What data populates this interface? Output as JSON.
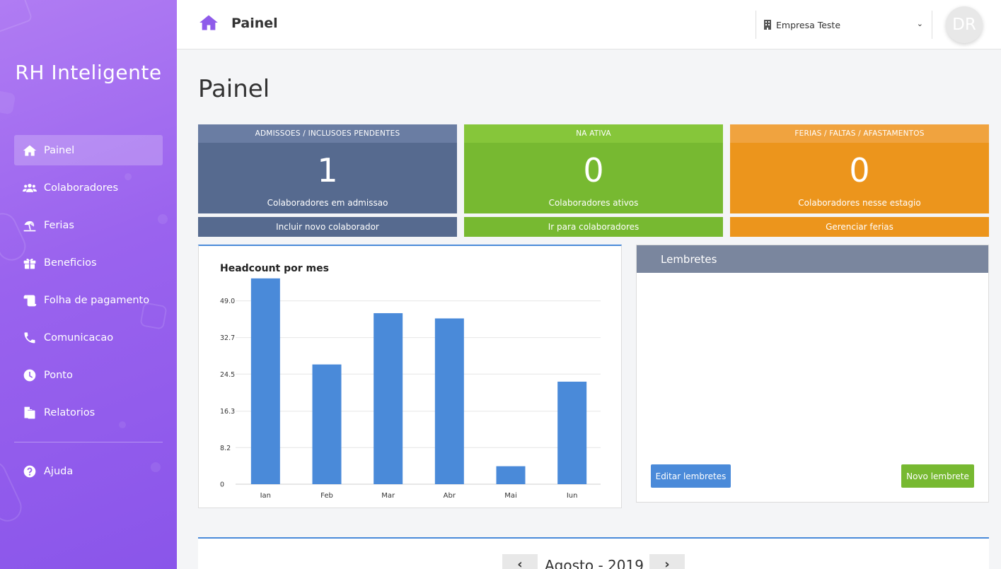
{
  "brand": "RH Inteligente",
  "sidebar": {
    "items": [
      {
        "label": "Painel",
        "icon": "home-icon",
        "active": true
      },
      {
        "label": "Colaboradores",
        "icon": "users-icon"
      },
      {
        "label": "Ferias",
        "icon": "umbrella-beach-icon"
      },
      {
        "label": "Beneficios",
        "icon": "gift-icon"
      },
      {
        "label": "Folha de pagamento",
        "icon": "scroll-icon"
      },
      {
        "label": "Comunicacao",
        "icon": "phone-icon"
      },
      {
        "label": "Ponto",
        "icon": "clock-icon"
      },
      {
        "label": "Relatorios",
        "icon": "copy-icon"
      }
    ],
    "help": {
      "label": "Ajuda",
      "icon": "question-circle-icon"
    }
  },
  "header": {
    "title": "Painel",
    "company": "Empresa Teste",
    "avatar_initials": "DR"
  },
  "page_title": "Painel",
  "stats": [
    {
      "header": "ADMISSOES / INCLUSOES PENDENTES",
      "value": "1",
      "caption": "Colaboradores em admissao",
      "action": "Incluir novo colaborador",
      "color": "#566a8f"
    },
    {
      "header": "NA ATIVA",
      "value": "0",
      "caption": "Colaboradores ativos",
      "action": "Ir para colaboradores",
      "color": "#77b931"
    },
    {
      "header": "FERIAS / FALTAS / AFASTAMENTOS",
      "value": "0",
      "caption": "Colaboradores nesse estagio",
      "action": "Gerenciar ferias",
      "color": "#ec951c"
    }
  ],
  "chart_data": {
    "type": "bar",
    "title": "Headcount por mes",
    "categories": [
      "Ian",
      "Feb",
      "Mar",
      "Abr",
      "Mai",
      "Iun"
    ],
    "values": [
      55,
      32,
      45.7,
      44.3,
      4.8,
      27.4
    ],
    "yticks": [
      "0",
      "8.2",
      "16.3",
      "24.5",
      "32.7",
      "49.0"
    ],
    "ylim": [
      0,
      49.0
    ],
    "bar_color": "#4a8ad9",
    "grid": true
  },
  "reminders": {
    "title": "Lembretes",
    "edit_label": "Editar lembretes",
    "new_label": "Novo lembrete"
  },
  "calendar": {
    "prev": "‹",
    "next": "›",
    "label": "Agosto - 2019"
  }
}
